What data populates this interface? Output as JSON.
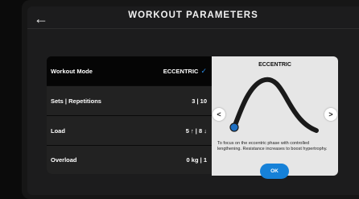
{
  "header": {
    "title": "WORKOUT PARAMETERS",
    "back_icon": "arrow-left-icon"
  },
  "parameters": {
    "workout_mode": {
      "label": "Workout Mode",
      "value": "ECCENTRIC",
      "check_icon": "check-icon"
    },
    "sets": {
      "label": "Sets | Repetitions",
      "value": "3 | 10"
    },
    "load": {
      "label": "Load",
      "value": "5 ↑ | 8 ↓"
    },
    "overload": {
      "label": "Overload",
      "value": "0 kg | 1"
    }
  },
  "mode_card": {
    "title": "ECCENTRIC",
    "description": "To focus on the eccentric phase with controlled lengthening. Resistance increases to boost hypertrophy.",
    "ok_label": "OK",
    "prev_label": "<",
    "next_label": ">"
  },
  "colors": {
    "accent": "#1681d8",
    "check": "#2b8ce6",
    "background": "#1c1c1d",
    "card": "#e6e6e6"
  }
}
